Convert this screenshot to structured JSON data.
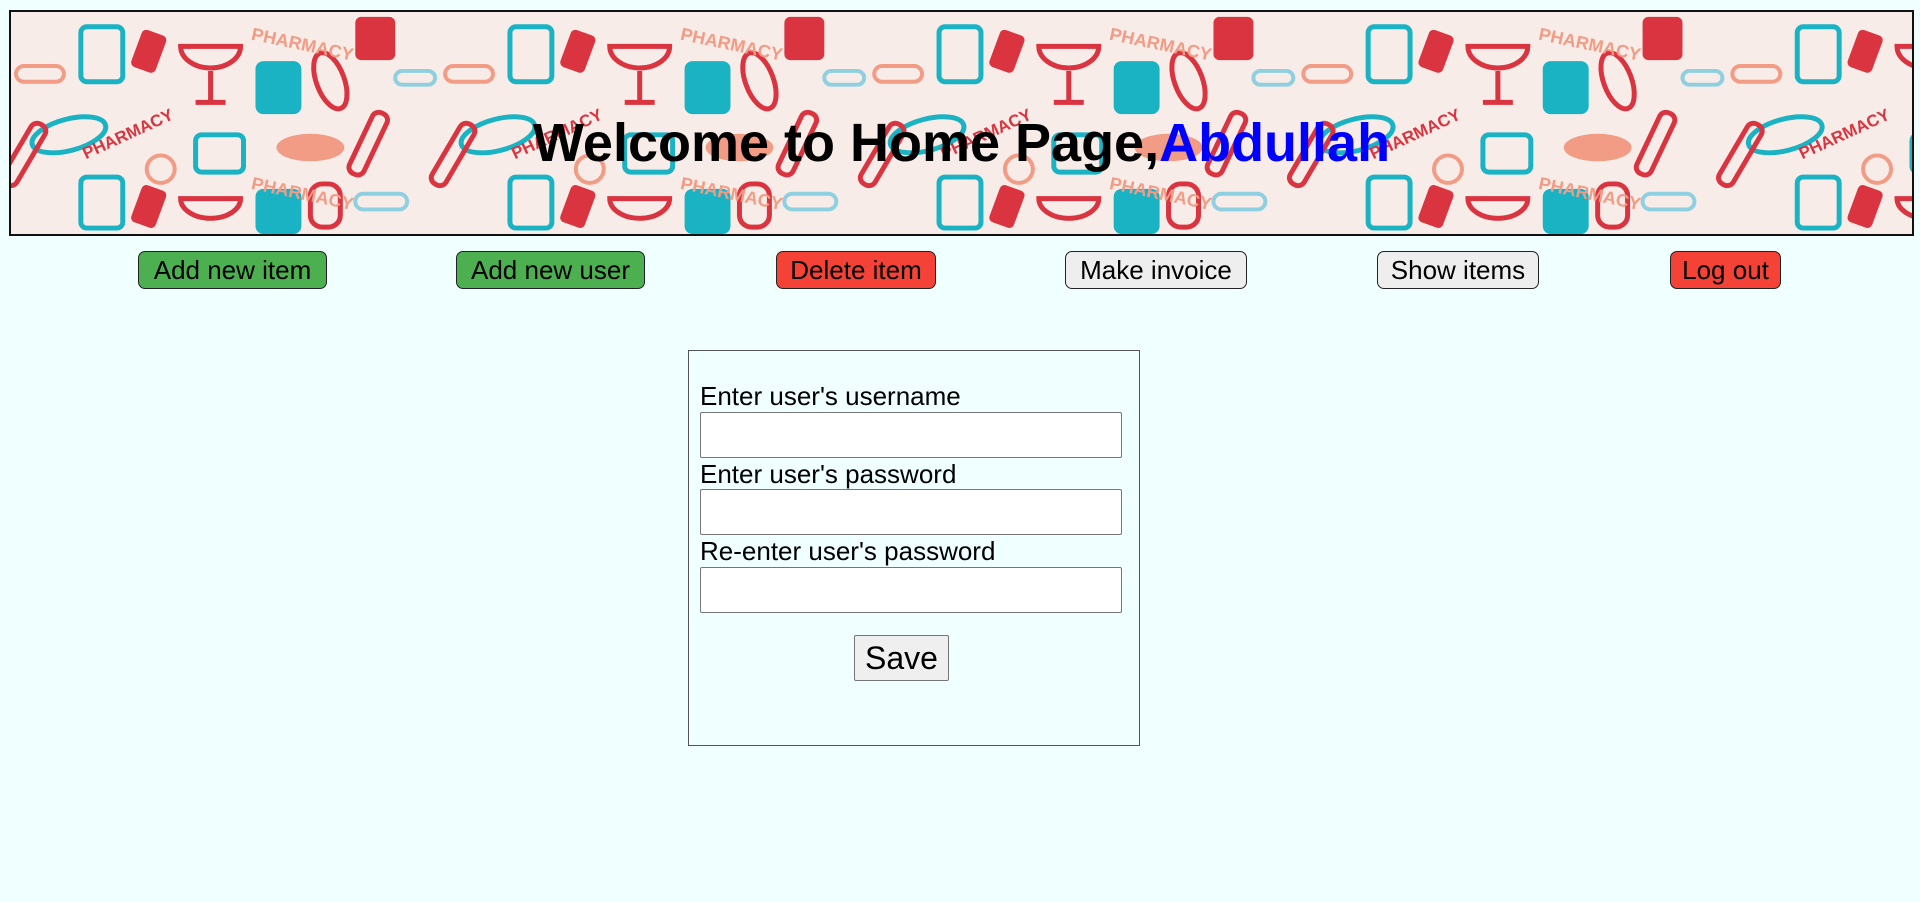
{
  "header": {
    "welcome_text": "Welcome to Home Page,",
    "user_name": "Abdullah",
    "pattern_word": "PHARMACY"
  },
  "nav": {
    "add_item": "Add new item",
    "add_user": "Add new user",
    "delete_item": "Delete item",
    "make_invoice": "Make invoice",
    "show_items": "Show items",
    "log_out": "Log out"
  },
  "form": {
    "username_label": "Enter user's username",
    "username_value": "",
    "password_label": "Enter user's password",
    "password_value": "",
    "reenter_label": "Re-enter user's password",
    "reenter_value": "",
    "save_label": "Save"
  },
  "colors": {
    "page_background": "#f0ffff",
    "accent_green": "#4caf50",
    "accent_red": "#f44336",
    "name_blue": "#0000ff",
    "pattern_red": "#d9343f",
    "pattern_teal": "#1ab3c4",
    "pattern_salmon": "#f29b85",
    "pattern_lightblue": "#8fd0e0"
  }
}
